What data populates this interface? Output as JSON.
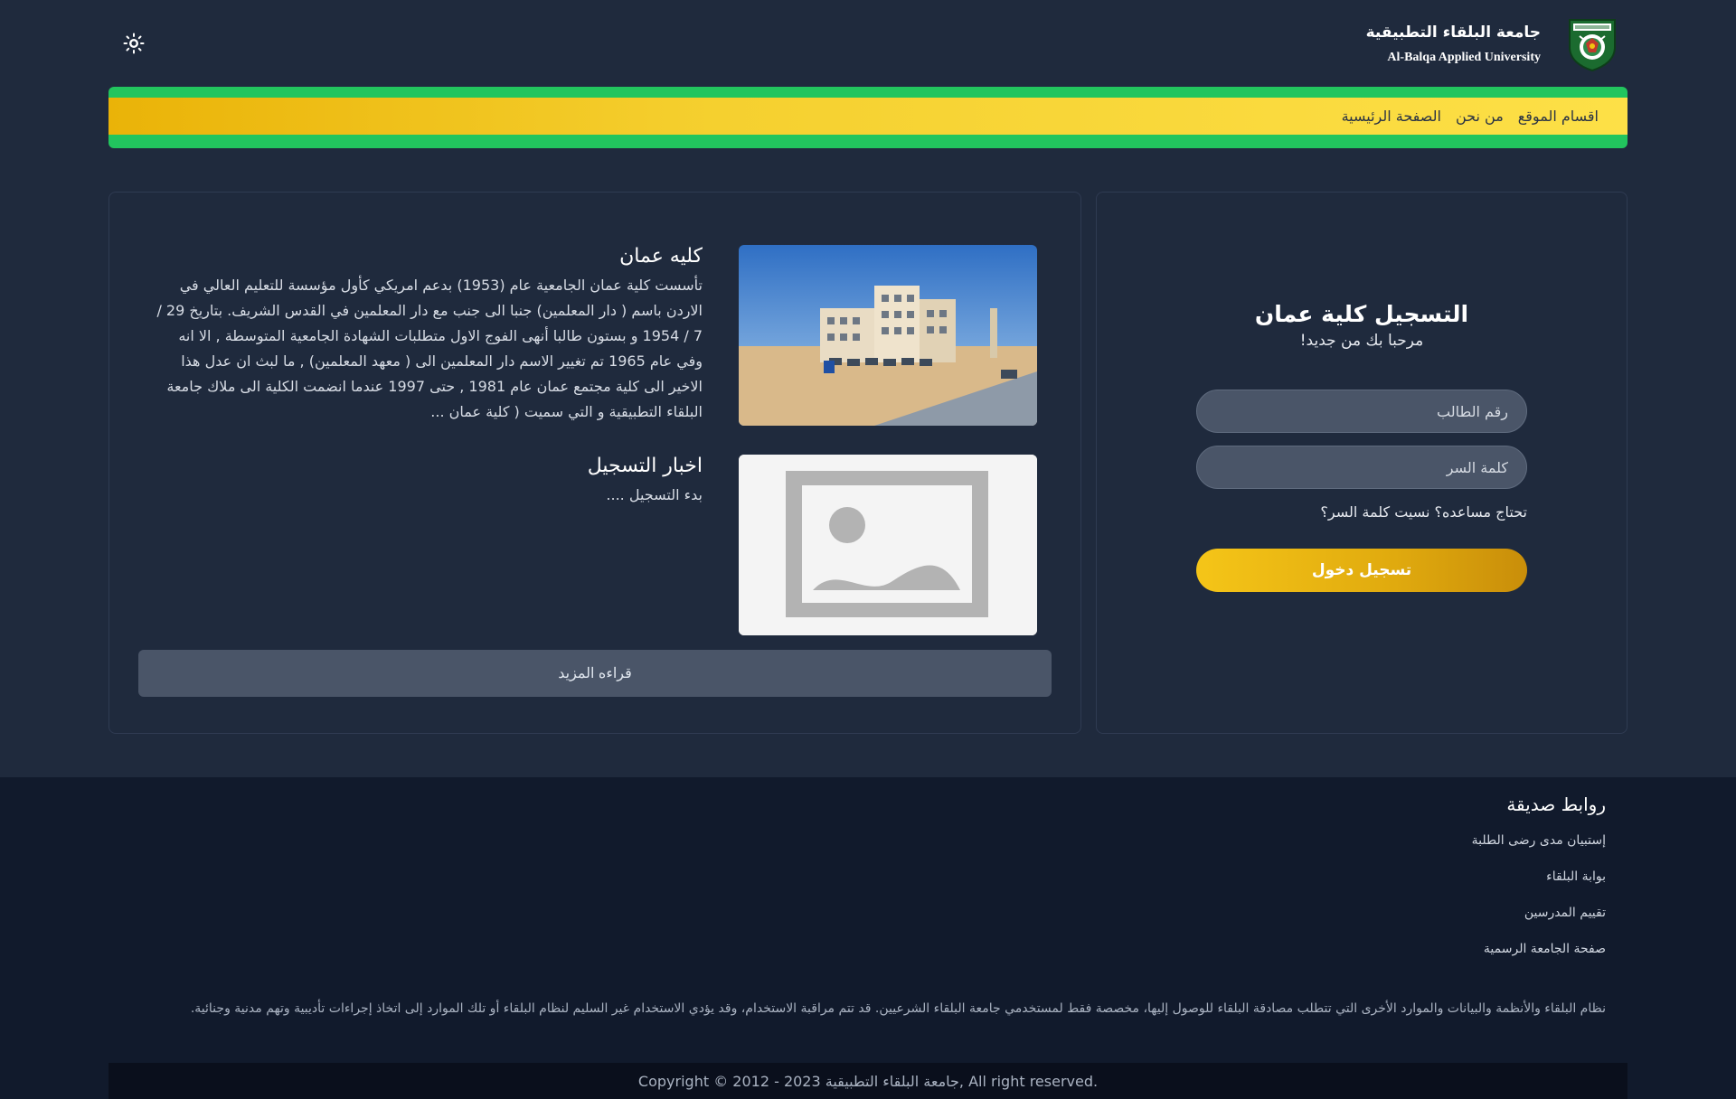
{
  "header": {
    "university_name_ar": "جامعة البلقاء التطبيقية",
    "university_name_en": "Al-Balqa Applied University",
    "theme_toggle_icon": "sun-icon"
  },
  "nav": {
    "items": [
      {
        "label": "الصفحة الرئيسية"
      },
      {
        "label": "من نحن"
      },
      {
        "label": "اقسام الموقع"
      }
    ],
    "colors": {
      "stripe": "#22c55e",
      "band_start": "#eab308",
      "band_end": "#fde047"
    }
  },
  "articles": [
    {
      "title": "كليه عمان",
      "text": "تأسست كلية عمان الجامعية عام (1953) بدعم امريكي كأول مؤسسة للتعليم العالي في الاردن باسم ( دار المعلمين) جنبا الى جنب مع دار المعلمين في القدس الشريف. بتاريخ 29 / 7 / 1954 و بستون طالبا أنهى الفوج الاول متطلبات الشهادة الجامعية المتوسطة , الا انه وفي عام 1965 تم تغيير الاسم دار المعلمين الى ( معهد المعلمين) , ما لبث ان عدل هذا الاخير الى كلية مجتمع عمان عام 1981 , حتى 1997 عندما انضمت الكلية الى ملاك جامعة البلقاء التطبيقية و التي سميت ( كلية عمان ...",
      "image": "campus-photo"
    },
    {
      "title": "اخبار التسجيل",
      "text": "بدء التسجيل ....",
      "image": "image-placeholder-icon"
    }
  ],
  "read_more_label": "قراءه المزيد",
  "login": {
    "title": "التسجيل كلية عمان",
    "subtitle": "مرحبا بك من جديد!",
    "student_id_placeholder": "رقم الطالب",
    "password_placeholder": "كلمة السر",
    "help_text": "تحتاج مساعده؟ نسيت كلمة السر؟",
    "submit_label": "تسجيل دخول"
  },
  "footer": {
    "links_title": "روابط صديقة",
    "links": [
      {
        "label": "إستبيان مدى رضى الطلبة"
      },
      {
        "label": "بوابة البلقاء"
      },
      {
        "label": "تقييم المدرسين"
      },
      {
        "label": "صفحة الجامعة الرسمية"
      }
    ],
    "disclaimer": "نظام البلقاء والأنظمة والبيانات والموارد الأخرى التي تتطلب مصادقة البلقاء للوصول إليها، مخصصة فقط لمستخدمي جامعة البلقاء الشرعيين. قد تتم مراقبة الاستخدام، وقد يؤدي الاستخدام غير السليم لنظام البلقاء أو تلك الموارد إلى اتخاذ إجراءات تأديبية وتهم مدنية وجنائية.",
    "copyright": "Copyright © 2012 - 2023 جامعة البلقاء التطبيقية, All right reserved."
  }
}
